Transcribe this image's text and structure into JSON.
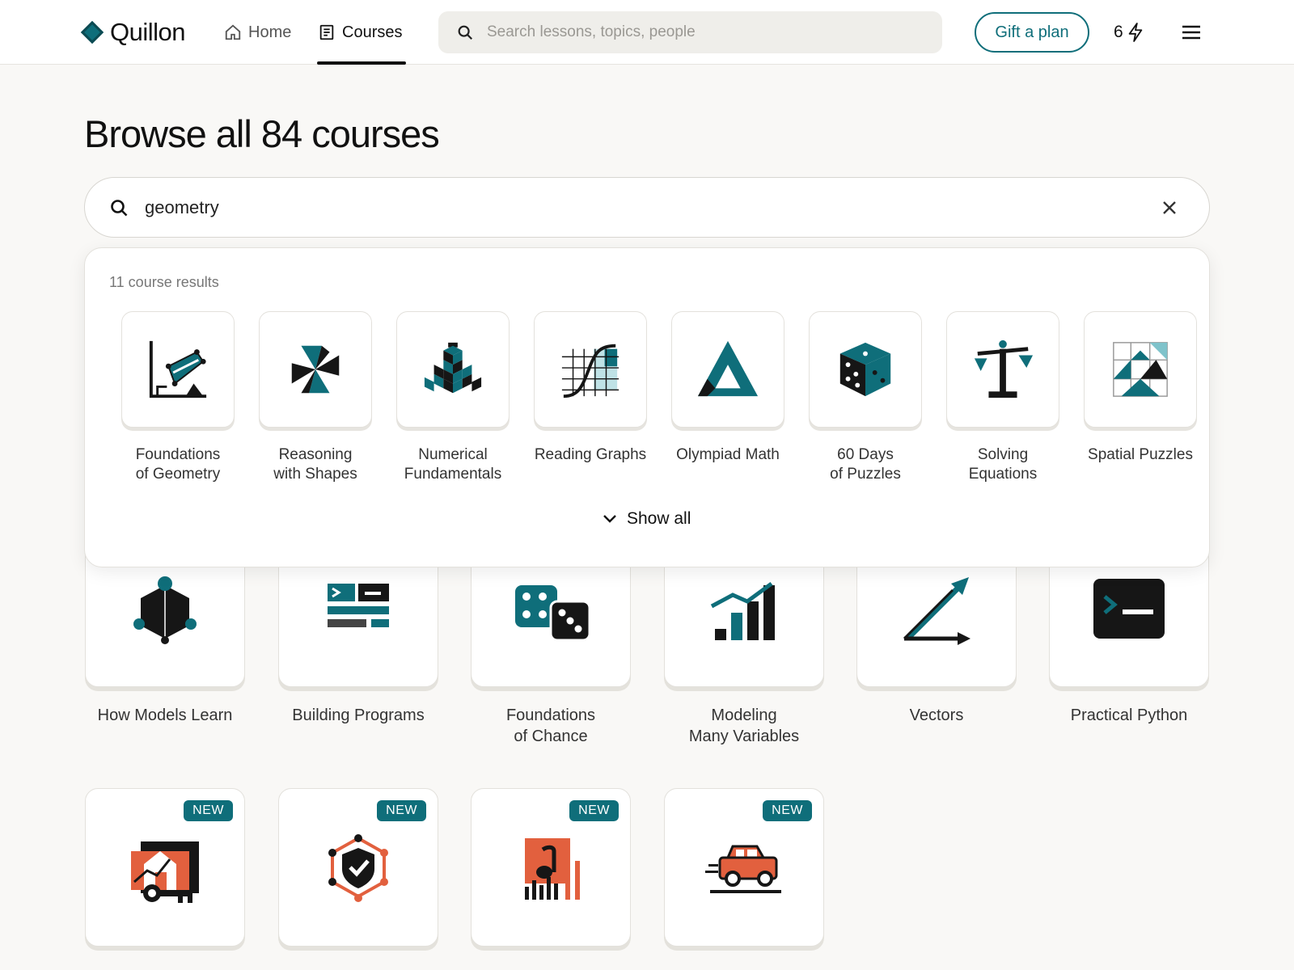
{
  "brand": {
    "name": "Quillon"
  },
  "nav": {
    "home_label": "Home",
    "courses_label": "Courses"
  },
  "top_search": {
    "placeholder": "Search lessons, topics, people"
  },
  "header": {
    "gift_label": "Gift a plan",
    "streak_count": "6"
  },
  "page": {
    "title": "Browse all 84 courses"
  },
  "search": {
    "value": "geometry"
  },
  "results": {
    "count_label": "11 course results",
    "show_all_label": "Show all",
    "items": [
      {
        "label": "Foundations\nof Geometry",
        "icon": "geometry-graph-icon"
      },
      {
        "label": "Reasoning\nwith Shapes",
        "icon": "pinwheel-icon"
      },
      {
        "label": "Numerical\nFundamentals",
        "icon": "cube-stack-icon"
      },
      {
        "label": "Reading Graphs",
        "icon": "curve-grid-icon"
      },
      {
        "label": "Olympiad Math",
        "icon": "triangle-icon"
      },
      {
        "label": "60 Days\nof Puzzles",
        "icon": "dice-icon"
      },
      {
        "label": "Solving\nEquations",
        "icon": "balance-scale-icon"
      },
      {
        "label": "Spatial Puzzles",
        "icon": "tile-puzzle-icon"
      }
    ]
  },
  "courses": {
    "row1": [
      {
        "label": "How Models Learn",
        "icon": "network-cube-icon"
      },
      {
        "label": "Building Programs",
        "icon": "code-blocks-icon"
      },
      {
        "label": "Foundations\nof Chance",
        "icon": "two-dice-icon"
      },
      {
        "label": "Modeling\nMany Variables",
        "icon": "bar-trend-icon"
      },
      {
        "label": "Vectors",
        "icon": "vector-arrows-icon"
      },
      {
        "label": "Practical Python",
        "icon": "terminal-icon"
      }
    ],
    "row2": [
      {
        "badge": "NEW",
        "icon": "house-key-icon"
      },
      {
        "badge": "NEW",
        "icon": "shield-network-icon"
      },
      {
        "badge": "NEW",
        "icon": "music-bars-icon"
      },
      {
        "badge": "NEW",
        "icon": "car-icon"
      }
    ]
  },
  "colors": {
    "accent": "#0f6e7a",
    "orange": "#e2603e",
    "ink": "#161616"
  }
}
